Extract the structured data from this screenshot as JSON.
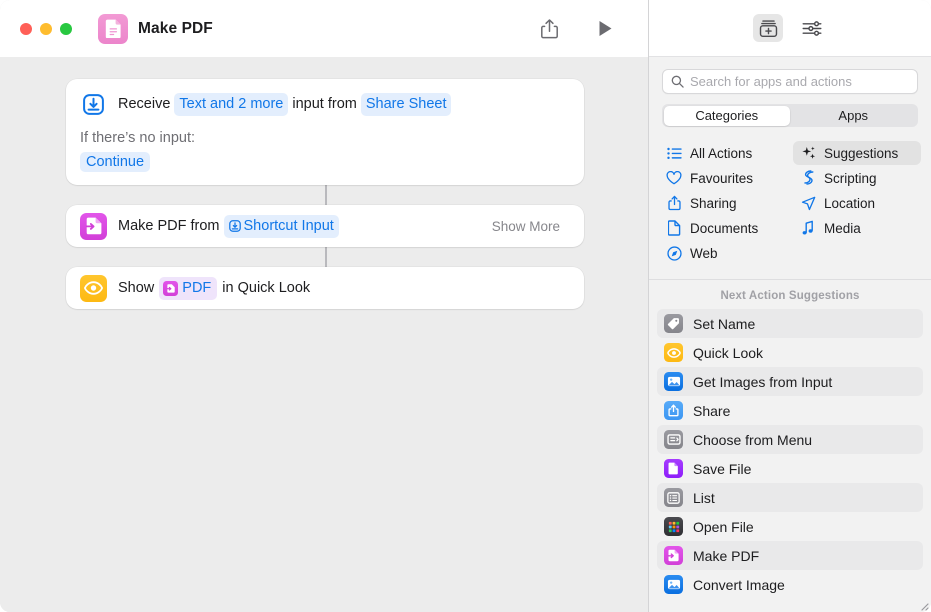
{
  "window": {
    "title": "Make PDF",
    "app_icon": "document-pdf-icon",
    "traffic_lights": [
      "close-button",
      "minimize-button",
      "zoom-button"
    ],
    "toolbar": {
      "share_label": "share-icon",
      "run_label": "play-icon"
    }
  },
  "flow": {
    "actions": [
      {
        "icon": "receive-input-icon",
        "segments": [
          {
            "type": "text",
            "text": "Receive"
          },
          {
            "type": "token",
            "text": "Text and 2 more"
          },
          {
            "type": "text",
            "text": "input from"
          },
          {
            "type": "token",
            "text": "Share Sheet"
          }
        ],
        "no_input_label": "If there’s no input:",
        "no_input_value": "Continue"
      },
      {
        "icon": "make-pdf-icon",
        "segments": [
          {
            "type": "text",
            "text": "Make PDF from"
          },
          {
            "type": "token",
            "text": "Shortcut Input",
            "glyph": "shortcut-input-icon"
          }
        ],
        "show_more": "Show More"
      },
      {
        "icon": "quick-look-icon",
        "segments": [
          {
            "type": "text",
            "text": "Show"
          },
          {
            "type": "token",
            "text": "PDF",
            "glyph": "pdf-variable-icon"
          },
          {
            "type": "text",
            "text": "in Quick Look"
          }
        ]
      }
    ]
  },
  "sidebar": {
    "toolbar": [
      {
        "name": "action-library-button",
        "label": "library-icon",
        "active": true
      },
      {
        "name": "shortcut-details-button",
        "label": "sliders-icon",
        "active": false
      }
    ],
    "search": {
      "placeholder": "Search for apps and actions",
      "value": "",
      "icon": "search-icon"
    },
    "segments": [
      {
        "label": "Categories",
        "active": true
      },
      {
        "label": "Apps",
        "active": false
      }
    ],
    "categories": [
      {
        "label": "All Actions",
        "icon": "list-bullet-icon",
        "active": false,
        "color": "#1177e8"
      },
      {
        "label": "Suggestions",
        "icon": "sparkles-icon",
        "active": true,
        "color": "#1d1d1f"
      },
      {
        "label": "Favourites",
        "icon": "heart-icon",
        "active": false,
        "color": "#1177e8"
      },
      {
        "label": "Scripting",
        "icon": "scripting-icon",
        "active": false,
        "color": "#1177e8"
      },
      {
        "label": "Sharing",
        "icon": "share-up-icon",
        "active": false,
        "color": "#1177e8"
      },
      {
        "label": "Location",
        "icon": "location-arrow-icon",
        "active": false,
        "color": "#1177e8"
      },
      {
        "label": "Documents",
        "icon": "document-icon",
        "active": false,
        "color": "#1177e8"
      },
      {
        "label": "Media",
        "icon": "music-note-icon",
        "active": false,
        "color": "#1177e8"
      },
      {
        "label": "Web",
        "icon": "safari-compass-icon",
        "active": false,
        "color": "#1177e8"
      }
    ],
    "suggestions_header": "Next Action Suggestions",
    "suggestions": [
      {
        "label": "Set Name",
        "icon": "tag-icon",
        "bg": "#8e8e93",
        "alt": true
      },
      {
        "label": "Quick Look",
        "icon": "eye-icon",
        "bg": "#ffc107",
        "alt": false
      },
      {
        "label": "Get Images from Input",
        "icon": "photo-icon",
        "bg": "#1177e8",
        "alt": true
      },
      {
        "label": "Share",
        "icon": "share-up-icon",
        "bg": "#46a0f5",
        "alt": false
      },
      {
        "label": "Choose from Menu",
        "icon": "menu-icon",
        "bg": "#8e8e93",
        "alt": true
      },
      {
        "label": "Save File",
        "icon": "save-file-icon",
        "bg": "#9b30ff",
        "alt": false
      },
      {
        "label": "List",
        "icon": "list-icon",
        "bg": "#8e8e93",
        "alt": true
      },
      {
        "label": "Open File",
        "icon": "apps-grid-icon",
        "bg": "#3a3a3c",
        "alt": false
      },
      {
        "label": "Make PDF",
        "icon": "make-pdf-icon",
        "bg": "#d94ae0",
        "alt": true
      },
      {
        "label": "Convert Image",
        "icon": "photo-icon",
        "bg": "#1177e8",
        "alt": false
      }
    ]
  },
  "colors": {
    "accent_blue": "#1177e8",
    "token_bg": "#e3eefd",
    "canvas_bg": "#ececec",
    "sidebar_bg": "#f2f2f2",
    "magenta": "#d94ae0",
    "pink": "#ec85cb",
    "amber": "#ffc107"
  }
}
